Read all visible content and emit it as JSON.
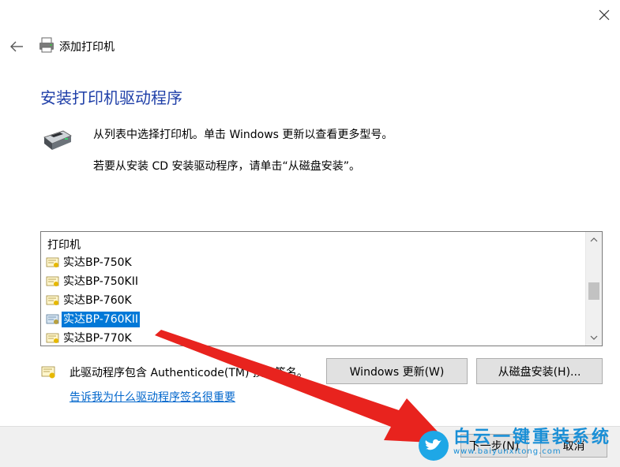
{
  "window": {
    "title": "添加打印机",
    "close_icon": "close-icon",
    "back_icon": "back-arrow-icon"
  },
  "page": {
    "heading": "安装打印机驱动程序",
    "description1": "从列表中选择打印机。单击 Windows 更新以查看更多型号。",
    "description2": "若要从安装 CD 安装驱动程序，请单击“从磁盘安装”。"
  },
  "printer_list": {
    "header": "打印机",
    "items": [
      {
        "label": "实达BP-750K",
        "selected": false
      },
      {
        "label": "实达BP-750KII",
        "selected": false
      },
      {
        "label": "实达BP-760K",
        "selected": false
      },
      {
        "label": "实达BP-760KII",
        "selected": true
      },
      {
        "label": "实达BP-770K",
        "selected": false
      }
    ]
  },
  "signature": {
    "text": "此驱动程序包含 Authenticode(TM) 技术签名。",
    "link": "告诉我为什么驱动程序签名很重要"
  },
  "buttons": {
    "windows_update": "Windows 更新(W)",
    "have_disk": "从磁盘安装(H)...",
    "next": "下一步(N)",
    "cancel": "取消"
  },
  "watermark": {
    "brand": "白云一键重装系统",
    "url": "www.baiyunxitong.com"
  },
  "colors": {
    "heading": "#1f3fa8",
    "selection": "#0078d7",
    "link": "#0066cc",
    "arrow": "#e8231e"
  }
}
